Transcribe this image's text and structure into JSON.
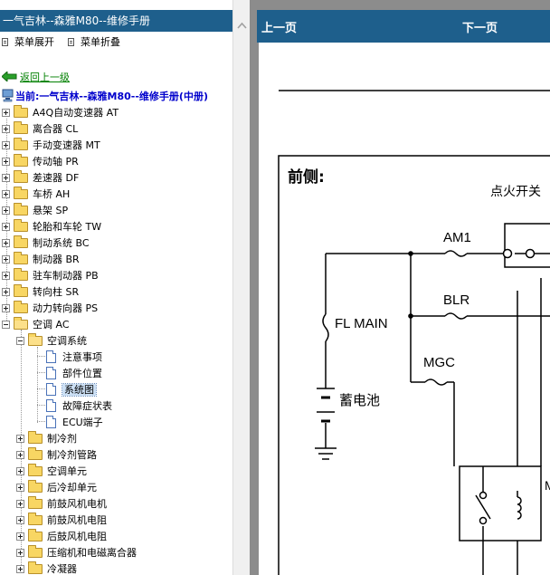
{
  "sidebar": {
    "title": "一气吉林--森雅M80--维修手册",
    "menu_expand": "菜单展开",
    "menu_collapse": "菜单折叠",
    "back": "返回上一级",
    "current": "当前:一气吉林--森雅M80--维修手册(中册)",
    "tree": [
      "A4Q自动变速器 AT",
      "离合器 CL",
      "手动变速器 MT",
      "传动轴 PR",
      "差速器 DF",
      "车桥 AH",
      "悬架 SP",
      "轮胎和车轮 TW",
      "制动系统 BC",
      "制动器 BR",
      "驻车制动器 PB",
      "转向柱 SR",
      "动力转向器 PS",
      "空调 AC"
    ],
    "ac_children": {
      "system_folder": "空调系统",
      "system_pages": [
        "注意事项",
        "部件位置",
        "系统图",
        "故障症状表",
        "ECU端子"
      ],
      "selected_page": "系统图",
      "folders": [
        "制冷剂",
        "制冷剂管路",
        "空调单元",
        "后冷却单元",
        "前鼓风机电机",
        "前鼓风机电阻",
        "后鼓风机电阻",
        "压缩机和电磁离合器",
        "冷凝器"
      ]
    }
  },
  "viewer": {
    "prev": "上一页",
    "next": "下一页"
  },
  "diagram": {
    "front_label": "前侧:",
    "ignition_label": "点火开关",
    "am1": "AM1",
    "blr": "BLR",
    "fl_main": "FL MAIN",
    "mgc": "MGC",
    "battery": "蓄电池",
    "m_label": "M"
  },
  "colors": {
    "title_bar": "#1e5f8c",
    "tree_link": "#008000",
    "current_path": "#0000cc"
  }
}
